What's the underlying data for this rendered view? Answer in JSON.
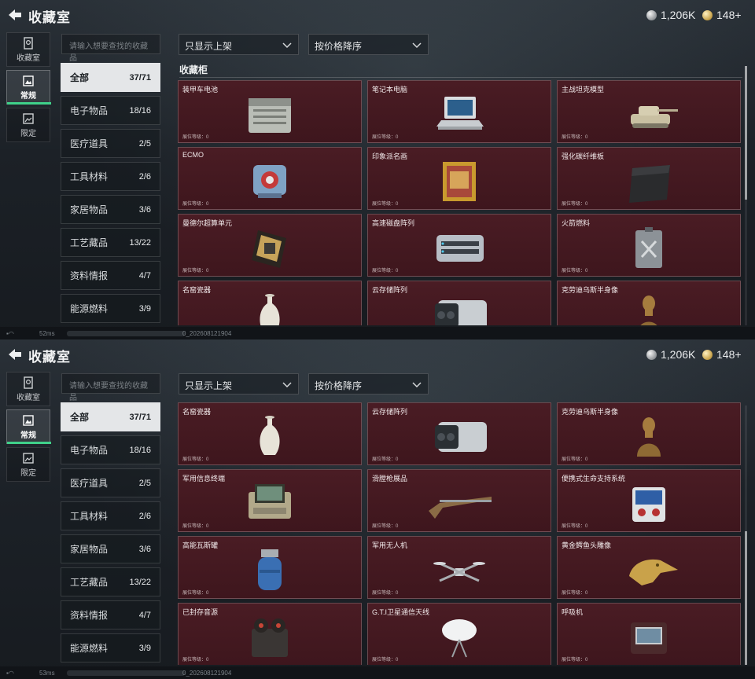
{
  "header": {
    "title": "收藏室",
    "silver_value": "1,206K",
    "gold_value": "148+"
  },
  "left_nav": [
    {
      "label": "收藏室",
      "icon": "collection-room-icon"
    },
    {
      "label": "常规",
      "icon": "regular-frame-icon"
    },
    {
      "label": "限定",
      "icon": "limited-frame-icon"
    }
  ],
  "search": {
    "placeholder": "请输入想要查找的收藏品"
  },
  "filters": {
    "shelf": "只显示上架",
    "sort": "按价格降序"
  },
  "categories": [
    {
      "label": "全部",
      "count": "37/71"
    },
    {
      "label": "电子物品",
      "count": "18/16"
    },
    {
      "label": "医疗道具",
      "count": "2/5"
    },
    {
      "label": "工具材料",
      "count": "2/6"
    },
    {
      "label": "家居物品",
      "count": "3/6"
    },
    {
      "label": "工艺藏品",
      "count": "13/22"
    },
    {
      "label": "资料情报",
      "count": "4/7"
    },
    {
      "label": "能源燃料",
      "count": "3/9"
    }
  ],
  "cabinet_title": "收藏柜",
  "level_label": "展位等级：0",
  "items": [
    {
      "name": "装甲车电池",
      "icon": "battery-icon"
    },
    {
      "name": "笔记本电脑",
      "icon": "laptop-icon"
    },
    {
      "name": "主战坦克模型",
      "icon": "tank-icon"
    },
    {
      "name": "ECMO",
      "icon": "ecmo-icon"
    },
    {
      "name": "印象派名画",
      "icon": "painting-icon"
    },
    {
      "name": "强化碳纤维板",
      "icon": "carbon-plate-icon"
    },
    {
      "name": "曼德尔超算单元",
      "icon": "compute-unit-icon"
    },
    {
      "name": "高速磁盘阵列",
      "icon": "disk-array-icon"
    },
    {
      "name": "火箭燃料",
      "icon": "fuel-can-icon"
    },
    {
      "name": "名窑瓷器",
      "icon": "vase-icon"
    },
    {
      "name": "云存储阵列",
      "icon": "cloud-storage-icon"
    },
    {
      "name": "克劳迪乌斯半身像",
      "icon": "bust-icon"
    },
    {
      "name": "军用信息终端",
      "icon": "terminal-icon"
    },
    {
      "name": "滑膛枪展品",
      "icon": "musket-icon"
    },
    {
      "name": "便携式生命支持系统",
      "icon": "life-support-icon"
    },
    {
      "name": "高能瓦斯罐",
      "icon": "gas-tank-icon"
    },
    {
      "name": "军用无人机",
      "icon": "drone-icon"
    },
    {
      "name": "黄金鳄鱼头雕像",
      "icon": "croc-head-icon"
    },
    {
      "name": "已封存音源",
      "icon": "reel-recorder-icon"
    },
    {
      "name": "G.T.I卫星通信天线",
      "icon": "satellite-dish-icon"
    },
    {
      "name": "呼吸机",
      "icon": "ventilator-icon"
    }
  ],
  "status": [
    {
      "ping": "52ms",
      "build": "0_202608121904"
    },
    {
      "ping": "53ms",
      "build": "0_202608121904"
    }
  ],
  "colors": {
    "accent": "#3fd18a",
    "card_bg": "#4a1c24"
  }
}
